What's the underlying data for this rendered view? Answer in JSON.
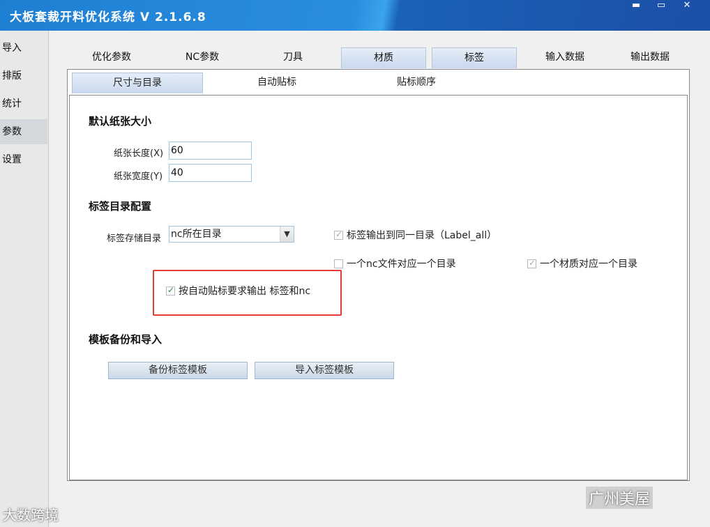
{
  "app": {
    "title": "大板套裁开料优化系统 V 2.1.6.8",
    "window_controls": {
      "minimize": "▬",
      "maximize": "▭",
      "close": "✕"
    }
  },
  "sidebar": {
    "items": [
      {
        "label": "导入"
      },
      {
        "label": "排版"
      },
      {
        "label": "统计"
      },
      {
        "label": "参数",
        "active": true
      },
      {
        "label": "设置"
      }
    ]
  },
  "top_tabs": [
    {
      "label": "优化参数"
    },
    {
      "label": "NC参数"
    },
    {
      "label": "刀具"
    },
    {
      "label": "材质",
      "active": true
    },
    {
      "label": "标签",
      "active": true
    },
    {
      "label": "输入数据"
    },
    {
      "label": "输出数据"
    }
  ],
  "sub_tabs": [
    {
      "label": "尺寸与目录",
      "active": true
    },
    {
      "label": "自动贴标"
    },
    {
      "label": "贴标顺序"
    }
  ],
  "paper_size": {
    "heading": "默认纸张大小",
    "length_label": "纸张长度(X)",
    "length_value": "60",
    "width_label": "纸张宽度(Y)",
    "width_value": "40"
  },
  "label_dir": {
    "heading": "标签目录配置",
    "storage_label": "标签存储目录",
    "storage_value": "nc所在目录",
    "opt_same_dir": {
      "label": "标签输出到同一目录（Label_all）",
      "checked": true
    },
    "opt_per_nc": {
      "label": "一个nc文件对应一个目录",
      "checked": false
    },
    "opt_per_material": {
      "label": "一个材质对应一个目录",
      "checked": true
    },
    "opt_auto_label": {
      "label": "按自动贴标要求输出 标签和nc",
      "checked": true
    }
  },
  "template": {
    "heading": "模板备份和导入",
    "backup_button": "备份标签模板",
    "import_button": "导入标签模板"
  },
  "watermarks": {
    "left": "大数跨境",
    "right": "广州美屋"
  },
  "colors": {
    "title_bar": "#1e7fd2",
    "highlight_border": "#e53935"
  }
}
